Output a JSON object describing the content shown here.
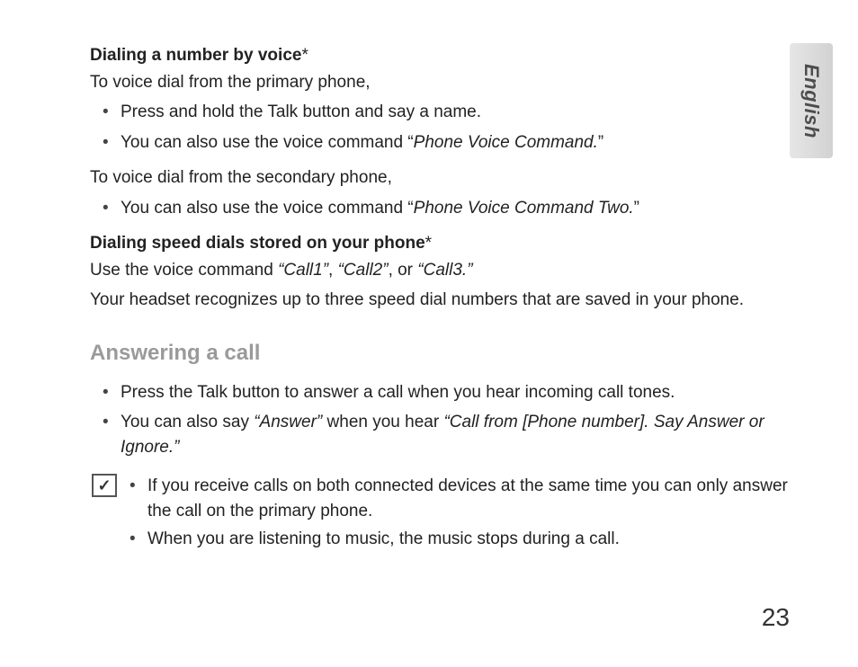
{
  "language_tab": "English",
  "section1": {
    "heading": "Dialing a number by voice",
    "asterisk": "*",
    "intro_primary": "To voice dial from the primary phone,",
    "bullets_primary": [
      {
        "text": "Press and hold the Talk button and say a name."
      },
      {
        "prefix": "You can also use the voice command “",
        "cmd": "Phone Voice Command.",
        "suffix": "”"
      }
    ],
    "intro_secondary": "To voice dial from the secondary phone,",
    "bullets_secondary": [
      {
        "prefix": "You can also use the voice command “",
        "cmd": "Phone Voice Command Two.",
        "suffix": "”"
      }
    ]
  },
  "section2": {
    "heading": "Dialing speed dials stored on your phone",
    "asterisk": "*",
    "line1_prefix": "Use the voice command ",
    "call1": "“Call1”",
    "sep1": ", ",
    "call2": "“Call2”",
    "sep2": ", or ",
    "call3": "“Call3.”",
    "line2": "Your headset recognizes up to three speed dial numbers that are saved in your phone."
  },
  "section3": {
    "title": "Answering a call",
    "bullets": [
      {
        "text": "Press the Talk button to answer a call when you hear incoming call tones."
      },
      {
        "prefix": "You can also say ",
        "cmd1": "“Answer”",
        "mid": " when you hear ",
        "cmd2": "“Call from [Phone number]. Say Answer or Ignore.”"
      }
    ],
    "note_icon": "✓",
    "notes": [
      "If you receive calls on both connected devices at the same time you can only answer the call on the primary phone.",
      "When you are listening to music, the music stops during a call."
    ]
  },
  "page_number": "23"
}
